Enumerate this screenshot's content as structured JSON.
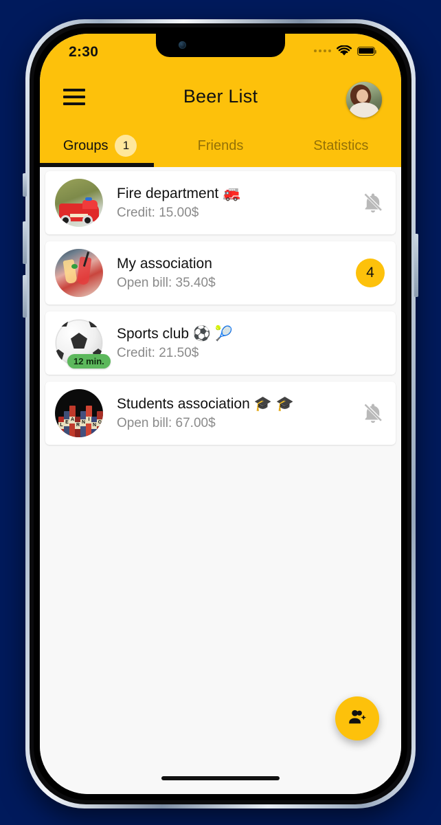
{
  "theme": {
    "accent": "#FDC10B",
    "badge_light": "#FFE79B",
    "screen_bg": "#F8F8F8",
    "card_bg": "#FFFFFF",
    "wallpaper": "#001A5C",
    "green_badge": "#5CB85C"
  },
  "status_bar": {
    "time": "2:30",
    "signal_icon": "signal-dots-icon",
    "wifi_icon": "wifi-icon",
    "battery_icon": "battery-full-icon"
  },
  "app_bar": {
    "menu_icon": "hamburger-menu-icon",
    "title": "Beer List",
    "avatar_icon": "user-avatar"
  },
  "tabs": [
    {
      "label": "Groups",
      "count": "1",
      "active": true
    },
    {
      "label": "Friends",
      "count": "",
      "active": false
    },
    {
      "label": "Statistics",
      "count": "",
      "active": false
    }
  ],
  "groups": [
    {
      "title": "Fire department 🚒",
      "subtitle": "Credit: 15.00$",
      "trailing_type": "bell-off",
      "trailing_value": "",
      "thumb": "fire-truck-photo",
      "time_badge": ""
    },
    {
      "title": "My association",
      "subtitle": "Open bill: 35.40$",
      "trailing_type": "badge",
      "trailing_value": "4",
      "thumb": "cocktail-party-photo",
      "time_badge": ""
    },
    {
      "title": "Sports club ⚽ 🎾",
      "subtitle": "Credit: 21.50$",
      "trailing_type": "none",
      "trailing_value": "",
      "thumb": "soccer-ball-photo",
      "time_badge": "12 min."
    },
    {
      "title": "Students association 🎓 🎓",
      "subtitle": "Open bill: 67.00$",
      "trailing_type": "bell-off",
      "trailing_value": "",
      "thumb": "books-photo",
      "time_badge": ""
    }
  ],
  "fab": {
    "icon": "person-add-icon",
    "label": ""
  },
  "books_spines": [
    "L",
    "E",
    "A",
    "R",
    "N",
    "I",
    "N",
    "G"
  ]
}
